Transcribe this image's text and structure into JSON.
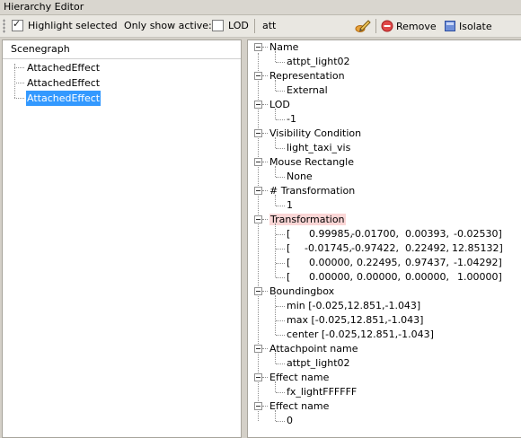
{
  "window": {
    "title": "Hierarchy Editor"
  },
  "toolbar": {
    "highlight_label": "Highlight selected",
    "highlight_checked": true,
    "only_active_label": "Only show active:",
    "lod_label": "LOD",
    "lod_checked": false,
    "search_value": "att",
    "remove_label": "Remove",
    "isolate_label": "Isolate"
  },
  "scenegraph": {
    "header": "Scenegraph",
    "items": [
      {
        "label": "AttachedEffect",
        "selected": false
      },
      {
        "label": "AttachedEffect",
        "selected": false
      },
      {
        "label": "AttachedEffect",
        "selected": true
      }
    ]
  },
  "properties": [
    {
      "name": "Name",
      "values": [
        "attpt_light02"
      ]
    },
    {
      "name": "Representation",
      "values": [
        "External"
      ]
    },
    {
      "name": "LOD",
      "values": [
        "-1"
      ]
    },
    {
      "name": "Visibility Condition",
      "values": [
        "light_taxi_vis"
      ]
    },
    {
      "name": "Mouse Rectangle",
      "values": [
        "None"
      ]
    },
    {
      "name": "# Transformation",
      "values": [
        "1"
      ]
    },
    {
      "name": "Transformation",
      "highlighted": true,
      "matrix": [
        [
          "0.99985,",
          "-0.01700,",
          "0.00393,",
          "-0.02530]"
        ],
        [
          "-0.01745,",
          "-0.97422,",
          "0.22492,",
          "12.85132]"
        ],
        [
          "0.00000,",
          "0.22495,",
          "0.97437,",
          "-1.04292]"
        ],
        [
          "0.00000,",
          "0.00000,",
          "0.00000,",
          "1.00000]"
        ]
      ]
    },
    {
      "name": "Boundingbox",
      "values": [
        "min [-0.025,12.851,-1.043]",
        "max [-0.025,12.851,-1.043]",
        "center [-0.025,12.851,-1.043]"
      ]
    },
    {
      "name": "Attachpoint name",
      "values": [
        "attpt_light02"
      ]
    },
    {
      "name": "Effect name",
      "values": [
        "fx_lightFFFFFF"
      ]
    },
    {
      "name": "Effect name",
      "values": [
        "0"
      ]
    }
  ]
}
